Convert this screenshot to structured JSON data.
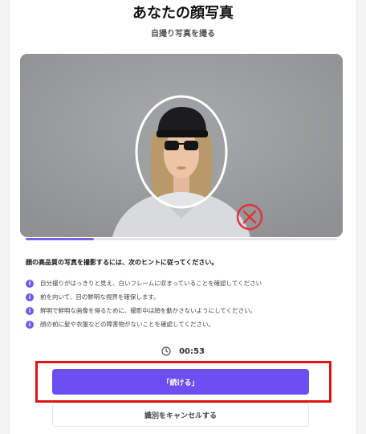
{
  "header": {
    "title": "あなたの顔写真",
    "subtitle": "自撮り写真を撮る"
  },
  "camera": {
    "status_icon": "close-circle-icon",
    "status_color": "#e0343f",
    "oval_color": "#ffffff"
  },
  "progress": {
    "fraction": 0.22,
    "fill_color": "#7b61e0"
  },
  "hints": {
    "heading": "顔の高品質の写真を撮影するには、次のヒントに従ってください。",
    "icon": "info-icon",
    "items": [
      "自分撮りがはっきりと見え、白いフレームに収まっていることを確認してください",
      "前を向いて、目の鮮明な視界を確保します。",
      "鮮明で鮮明な画像を得るために、撮影中は顔を動かさないようにしてください。",
      "顔の前に髪や衣服などの障害物がないことを確認してください。"
    ]
  },
  "timer": {
    "icon": "clock-icon",
    "value": "00:53"
  },
  "actions": {
    "continue_label": "「続ける」",
    "cancel_label": "識別をキャンセルする",
    "accent": "#6c4ff0",
    "highlight": "#e01414"
  }
}
